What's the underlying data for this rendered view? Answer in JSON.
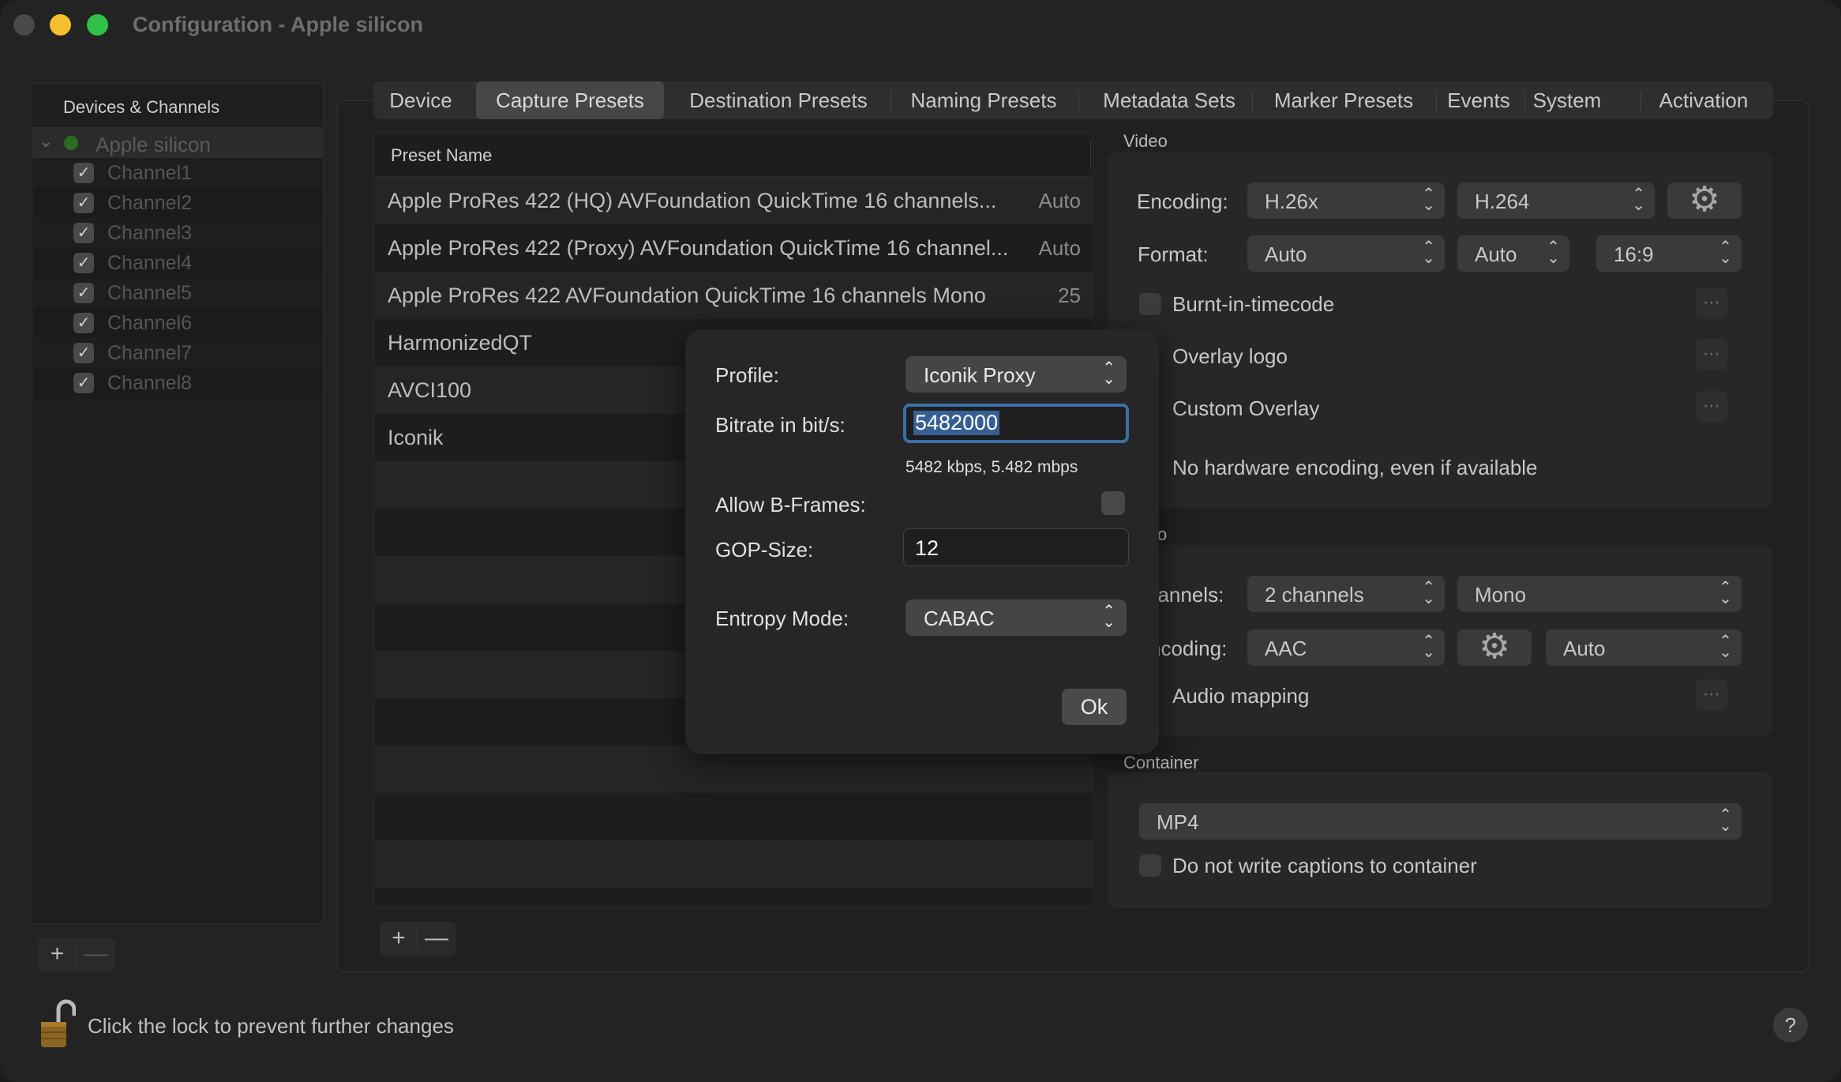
{
  "window": {
    "title": "Configuration - Apple silicon"
  },
  "sidebar": {
    "header": "Devices & Channels",
    "device": "Apple silicon",
    "channels": [
      "Channel1",
      "Channel2",
      "Channel3",
      "Channel4",
      "Channel5",
      "Channel6",
      "Channel7",
      "Channel8"
    ],
    "add_label": "+",
    "remove_label": "—"
  },
  "tabs": [
    "Device",
    "Capture Presets",
    "Destination Presets",
    "Naming Presets",
    "Metadata Sets",
    "Marker Presets",
    "Events",
    "System",
    "Activation"
  ],
  "active_tab": "Capture Presets",
  "presets": {
    "column_header": "Preset Name",
    "rows": [
      {
        "name": "Apple ProRes 422 (HQ) AVFoundation QuickTime 16 channels...",
        "value": "Auto"
      },
      {
        "name": "Apple ProRes 422 (Proxy) AVFoundation QuickTime 16 channel...",
        "value": "Auto"
      },
      {
        "name": "Apple ProRes 422 AVFoundation QuickTime 16 channels Mono",
        "value": "25"
      },
      {
        "name": "HarmonizedQT",
        "value": ""
      },
      {
        "name": "AVCI100",
        "value": ""
      },
      {
        "name": "Iconik",
        "value": ""
      }
    ],
    "add_label": "+",
    "remove_label": "—"
  },
  "video": {
    "section_title": "Video",
    "encoding_label": "Encoding:",
    "encoding_family": "H.26x",
    "encoding_codec": "H.264",
    "format_label": "Format:",
    "format_1": "Auto",
    "format_2": "Auto",
    "format_3": "16:9",
    "burnt_in": "Burnt-in-timecode",
    "overlay_logo": "Overlay logo",
    "custom_overlay": "Custom Overlay",
    "no_hw": "No hardware encoding, even if available"
  },
  "audio": {
    "section_title_partial": "o",
    "channels_label": "hannels:",
    "channels_value": "2 channels",
    "channels_mode": "Mono",
    "encoding_label": "ncoding:",
    "encoding_value": "AAC",
    "encoding_rate": "Auto",
    "mapping": "Audio mapping"
  },
  "container": {
    "section_title": "Container",
    "value": "MP4",
    "no_captions": "Do not write captions to container"
  },
  "sheet": {
    "profile_label": "Profile:",
    "profile_value": "Iconik Proxy",
    "bitrate_label": "Bitrate in bit/s:",
    "bitrate_value": "5482000",
    "bitrate_hint": "5482 kbps, 5.482 mbps",
    "bframes_label": "Allow B-Frames:",
    "gop_label": "GOP-Size:",
    "gop_value": "12",
    "entropy_label": "Entropy Mode:",
    "entropy_value": "CABAC",
    "ok_label": "Ok"
  },
  "footer": {
    "lock_text": "Click the lock to prevent further changes",
    "help_label": "?"
  },
  "icons": {
    "checkmark": "✓",
    "chevron_down": "⌄",
    "popup_arrows": "⌃⌄",
    "gear": "⚙",
    "more": "⋯"
  }
}
